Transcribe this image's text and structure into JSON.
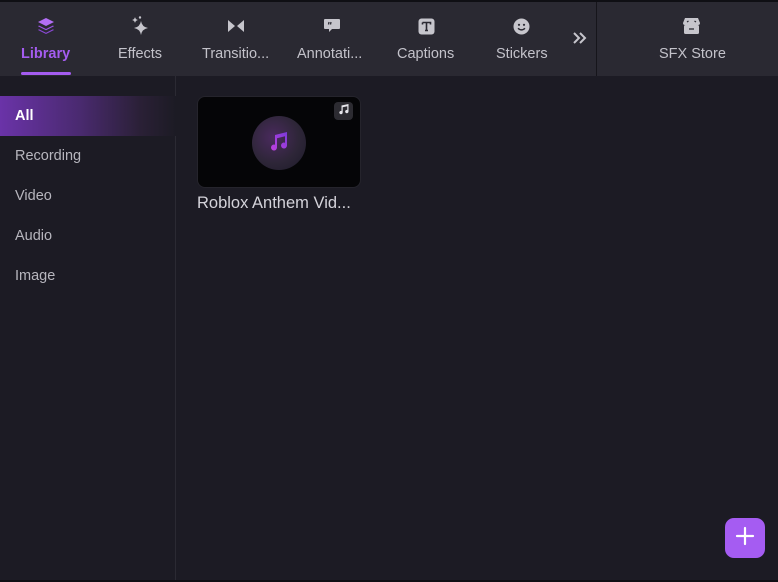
{
  "topbar": {
    "tabs": [
      {
        "id": "library",
        "label": "Library",
        "icon": "layers-icon",
        "active": true
      },
      {
        "id": "effects",
        "label": "Effects",
        "icon": "sparkles-icon",
        "active": false
      },
      {
        "id": "transitions",
        "label": "Transitio...",
        "icon": "bowtie-icon",
        "active": false
      },
      {
        "id": "annotations",
        "label": "Annotati...",
        "icon": "speech-bubble-icon",
        "active": false
      },
      {
        "id": "captions",
        "label": "Captions",
        "icon": "text-box-icon",
        "active": false
      },
      {
        "id": "stickers",
        "label": "Stickers",
        "icon": "smiley-icon",
        "active": false
      }
    ],
    "more_icon": "double-chevron-right-icon",
    "store": {
      "label": "SFX Store",
      "icon": "store-icon"
    }
  },
  "sidebar": {
    "items": [
      {
        "label": "All",
        "active": true
      },
      {
        "label": "Recording",
        "active": false
      },
      {
        "label": "Video",
        "active": false
      },
      {
        "label": "Audio",
        "active": false
      },
      {
        "label": "Image",
        "active": false
      }
    ]
  },
  "library": {
    "items": [
      {
        "title": "Roblox Anthem Vid...",
        "type": "audio",
        "type_icon": "music-note-icon"
      }
    ]
  },
  "fab": {
    "icon": "plus-icon"
  },
  "colors": {
    "accent": "#a45cf0",
    "background": "#1c1b24",
    "topbar": "#2a2932"
  }
}
